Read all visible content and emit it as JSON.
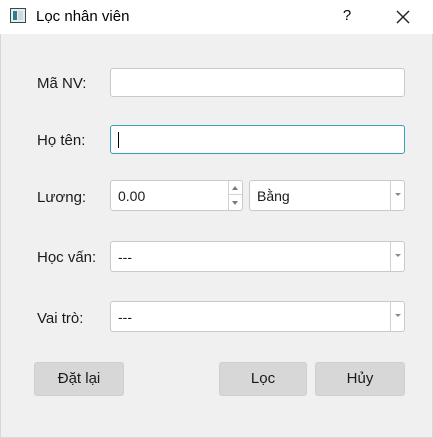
{
  "window": {
    "title": "Lọc nhân viên",
    "help_label": "?",
    "close_icon": "close-icon"
  },
  "form": {
    "employee_id": {
      "label": "Mã NV:",
      "value": ""
    },
    "full_name": {
      "label": "Họ tên:",
      "value": ""
    },
    "salary": {
      "label": "Lương:",
      "value": "0.00",
      "operator": "Bằng"
    },
    "education": {
      "label": "Học vấn:",
      "value": "---"
    },
    "role": {
      "label": "Vai trò:",
      "value": "---"
    }
  },
  "buttons": {
    "reset": "Đặt lại",
    "filter": "Lọc",
    "cancel": "Hủy"
  },
  "colors": {
    "focus_border": "#3aa0b7",
    "dialog_background": "#f0f0f0",
    "button_background": "#d7d7d7"
  }
}
